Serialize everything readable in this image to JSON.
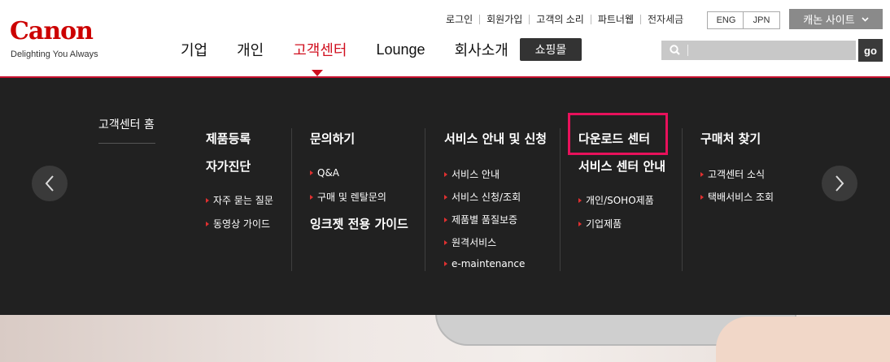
{
  "logo": {
    "wordmark": "Canon",
    "tagline": "Delighting You Always"
  },
  "util_links": [
    "로그인",
    "회원가입",
    "고객의 소리",
    "파트너웹"
  ],
  "util_plain": "전자세금",
  "lang": [
    "ENG",
    "JPN"
  ],
  "site_button": "캐논 사이트",
  "nav": [
    "기업",
    "개인",
    "고객센터",
    "Lounge",
    "회사소개"
  ],
  "nav_active_index": 2,
  "shop_button": "쇼핑몰",
  "search": {
    "placeholder": "",
    "button": "go"
  },
  "megamenu": {
    "home": "고객센터 홈",
    "col1": {
      "headings": [
        "제품등록",
        "자가진단"
      ],
      "links": [
        "자주 묻는 질문",
        "동영상 가이드"
      ]
    },
    "col2": {
      "heading": "문의하기",
      "links": [
        "Q&A",
        "구매 및 렌탈문의"
      ],
      "heading2": "잉크젯 전용 가이드"
    },
    "col3": {
      "heading": "서비스 안내 및 신청",
      "links": [
        "서비스 안내",
        "서비스 신청/조회",
        "제품별 품질보증",
        "원격서비스",
        "e-maintenance"
      ]
    },
    "col4": {
      "heading": "다운로드 센터",
      "heading2": "서비스 센터 안내",
      "links": [
        "개인/SOHO제품",
        "기업제품"
      ]
    },
    "col5": {
      "heading": "구매처 찾기",
      "links": [
        "고객센터 소식",
        "택배서비스 조회"
      ]
    }
  },
  "colors": {
    "brand_red": "#cc0000",
    "panel_bg": "#212121",
    "highlight": "#e8115b"
  }
}
